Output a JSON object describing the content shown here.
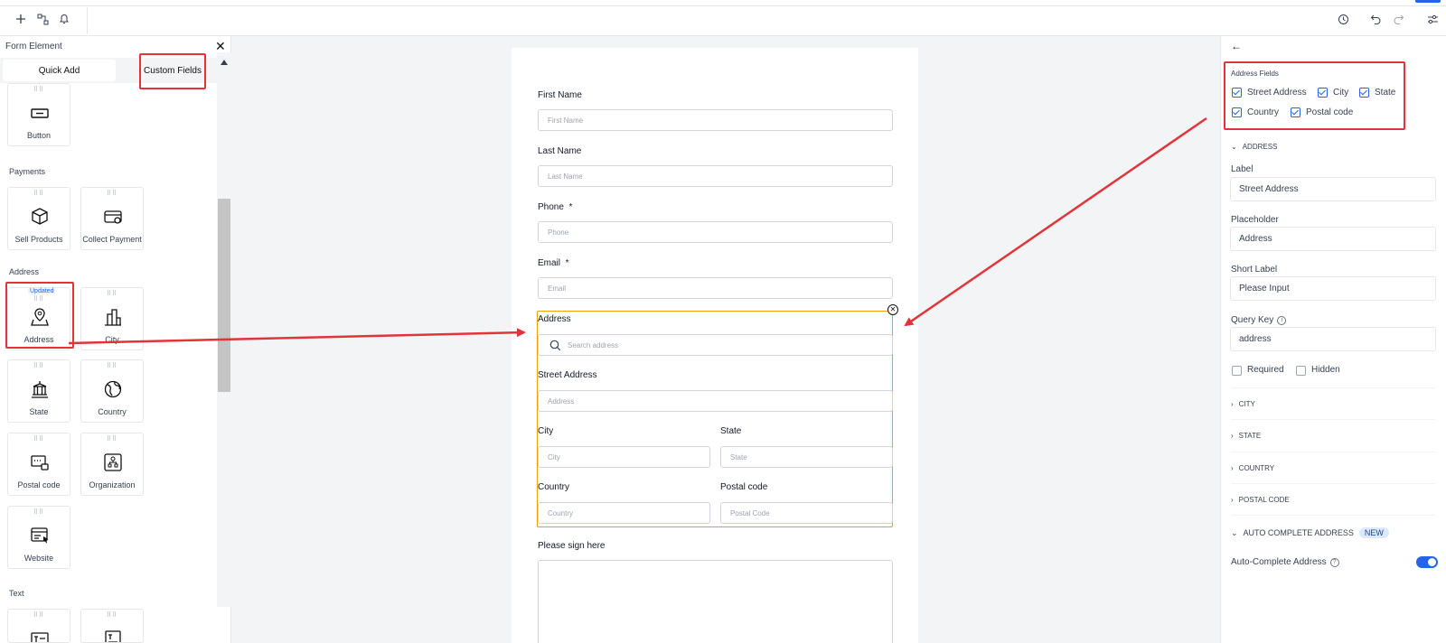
{
  "toolbar": {
    "icons": [
      "plus-icon",
      "flow-icon",
      "bell-icon",
      "history-icon",
      "undo-icon",
      "redo-icon",
      "settings-icon"
    ]
  },
  "left_panel": {
    "title": "Form Element",
    "tabs": {
      "quick_add": "Quick Add",
      "custom_fields": "Custom Fields"
    },
    "items": {
      "button": "Button",
      "payments_section": "Payments",
      "sell_products": "Sell Products",
      "collect_payment": "Collect Payment",
      "address_section": "Address",
      "address": "Address",
      "updated_badge": "Updated",
      "city": "City",
      "state": "State",
      "country": "Country",
      "postal_code": "Postal code",
      "organization": "Organization",
      "website": "Website",
      "text_section": "Text"
    }
  },
  "form": {
    "first_name": {
      "label": "First Name",
      "placeholder": "First Name"
    },
    "last_name": {
      "label": "Last Name",
      "placeholder": "Last Name"
    },
    "phone": {
      "label": "Phone",
      "required": "*",
      "placeholder": "Phone"
    },
    "email": {
      "label": "Email",
      "required": "*",
      "placeholder": "Email"
    },
    "address": {
      "label": "Address",
      "search_placeholder": "Search address",
      "street_label": "Street Address",
      "street_placeholder": "Address",
      "city_label": "City",
      "city_placeholder": "City",
      "state_label": "State",
      "state_placeholder": "State",
      "country_label": "Country",
      "country_placeholder": "Country",
      "postal_label": "Postal code",
      "postal_placeholder": "Postal Code"
    },
    "signature": {
      "label": "Please sign here"
    }
  },
  "right_panel": {
    "address_fields_title": "Address Fields",
    "checkboxes": {
      "street": "Street Address",
      "city": "City",
      "state": "State",
      "country": "Country",
      "postal": "Postal code"
    },
    "address_section": "ADDRESS",
    "label_title": "Label",
    "label_value": "Street Address",
    "placeholder_title": "Placeholder",
    "placeholder_value": "Address",
    "short_label_title": "Short Label",
    "short_label_value": "Please Input",
    "query_key_title": "Query Key",
    "query_key_value": "address",
    "required": "Required",
    "hidden": "Hidden",
    "sections": {
      "city": "CITY",
      "state": "STATE",
      "country": "COUNTRY",
      "postal": "POSTAL CODE"
    },
    "auto_complete_section": "AUTO COMPLETE ADDRESS",
    "new_badge": "NEW",
    "auto_complete_label": "Auto-Complete Address",
    "auto_complete_enabled": true
  },
  "colors": {
    "accent": "#2563eb",
    "annotation": "#e0343a",
    "selection": "#f59e0b"
  }
}
